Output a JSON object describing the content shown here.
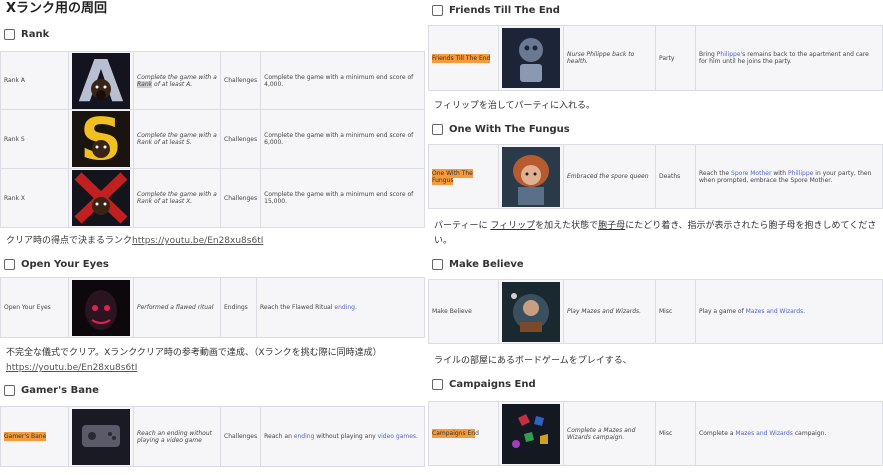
{
  "left": {
    "title": "Xランク用の周回",
    "sections": [
      {
        "check_label": "Rank",
        "rows": [
          {
            "name": "Rank A",
            "desc_pre": "Complete the game with a ",
            "desc_hl": "Rank",
            "desc_post": " of at least A.",
            "category": "Challenges",
            "requirement": "Complete the game with a minimum end score of 4,000.",
            "icon": "rank-a-art"
          },
          {
            "name": "Rank S",
            "desc_pre": "Complete the game with a Rank of at least S.",
            "desc_hl": "",
            "desc_post": "",
            "category": "Challenges",
            "requirement": "Complete the game with a minimum end score of 6,000.",
            "icon": "rank-s-art"
          },
          {
            "name": "Rank X",
            "desc_pre": "Complete the game with a Rank of at least X.",
            "desc_hl": "",
            "desc_post": "",
            "category": "Challenges",
            "requirement": "Complete the game with a minimum end score of 15,000.",
            "icon": "rank-x-art"
          }
        ],
        "note_text": "クリア時の得点で決まるランク",
        "note_url": "https://youtu.be/En28xu8s6tI"
      },
      {
        "check_label": "Open Your Eyes",
        "row": {
          "name": "Open Your Eyes",
          "desc": "Performed a flawed ritual",
          "category": "Endings",
          "req_pre": "Reach the Flawed Ritual ",
          "req_link": "ending",
          "req_post": ".",
          "icon": "flawed-ritual-art"
        },
        "note_text": "不完全な儀式でクリア。Xランククリア時の参考動画で達成、（Xランクを挑む際に同時達成）",
        "note_url": "https://youtu.be/En28xu8s6tI"
      },
      {
        "check_label": "Gamer's Bane",
        "row": {
          "name": "Gamer's Bane",
          "desc": "Reach an ending without playing a video game",
          "category": "Challenges",
          "req_pre": "Reach an ",
          "req_link": "ending",
          "req_mid": " without playing any ",
          "req_link2": "video games",
          "req_post": ".",
          "icon": "console-art"
        }
      }
    ]
  },
  "right": {
    "sections": [
      {
        "check_label": "Friends Till The End",
        "row": {
          "name": "Friends Till The End",
          "desc": "Nurse Philippe back to health.",
          "category": "Party",
          "req_pre": "Bring ",
          "req_link": "Philippe",
          "req_post": "'s remains back to the apartment and care for him until he joins the party.",
          "icon": "philippe-art"
        },
        "note_text": "フィリップを治してパーティに入れる。"
      },
      {
        "check_label": "One With The Fungus",
        "row": {
          "name_part1": "One With The",
          "name_part2": "Fungus",
          "desc": "Embraced the spore queen",
          "category": "Deaths",
          "req_pre": "Reach the ",
          "req_link": "Spore Mother",
          "req_mid": " with ",
          "req_link2": "Phillippe",
          "req_post": " in your party, then when prompted, embrace the Spore Mother.",
          "icon": "spore-queen-art"
        },
        "note_pre": "パーティーに ",
        "note_ul1": "フィリップ",
        "note_mid": "を加えた状態で",
        "note_ul2": "胞子母",
        "note_post": "にたどり着き、指示が表示されたら胞子母を抱きしめてください。"
      },
      {
        "check_label": "Make Believe",
        "row": {
          "name": "Make Believe",
          "desc": "Play Mazes and Wizards.",
          "category": "Misc",
          "req_pre": "Play a game of ",
          "req_link": "Mazes and Wizards",
          "req_post": ".",
          "icon": "mazes-wizards-art"
        },
        "note_text": "ライルの部屋にあるボードゲームをプレイする、"
      },
      {
        "check_label": "Campaigns End",
        "row": {
          "name_hl": "Campaigns En",
          "name_rest": "d",
          "desc": "Complete a Mazes and Wizards campaign.",
          "category": "Misc",
          "req_pre": "Complete a ",
          "req_link": "Mazes and Wizards",
          "req_post": " campaign.",
          "icon": "dice-art"
        }
      }
    ]
  },
  "colors": {
    "highlight": "#f59b3c",
    "link": "#5564c4",
    "border": "#dcdce4",
    "row_bg": "#f6f6f8"
  }
}
